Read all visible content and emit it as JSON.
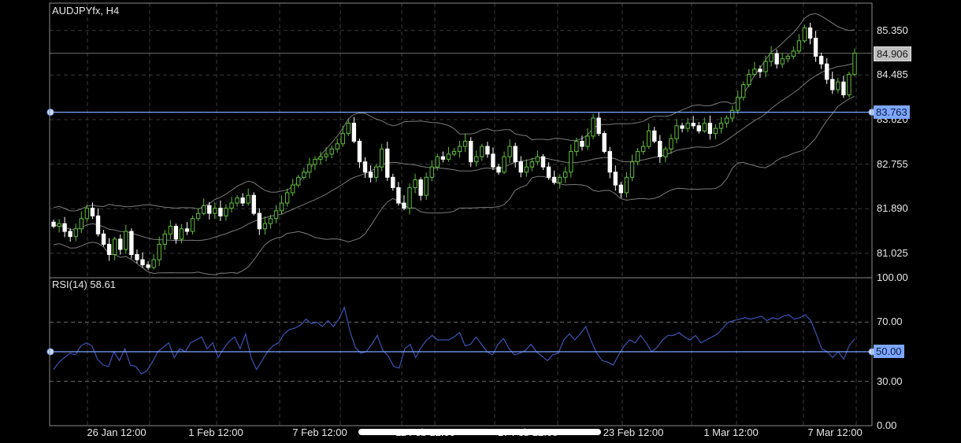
{
  "symbol_label": "AUDJPYfx, H4",
  "rsi_label": "RSI(14) 58.61",
  "price_tick_labels": [
    "85.350",
    "84.485",
    "83.620",
    "82.755",
    "81.890",
    "81.025"
  ],
  "current_price_label": "84.906",
  "hline_price_label": "83.763",
  "rsi_tick_labels": [
    "100.00",
    "70.00",
    "30.00",
    "0.00"
  ],
  "rsi_hline_label": "50.00",
  "time_labels": [
    "26 Jan 12:00",
    "1 Feb 12:00",
    "7 Feb 12:00",
    "11 Feb 12:00",
    "17 Feb 12:00",
    "23 Feb 12:00",
    "1 Mar 12:00",
    "7 Mar 12:00"
  ],
  "colors": {
    "background": "#000000",
    "grid": "#3a3a3a",
    "frame": "#8a8a8a",
    "bull_candle_fill": "#000000",
    "bull_candle_stroke": "#5fbf3a",
    "bear_candle": "#ffffff",
    "bollinger": "#9a9a9a",
    "horizontal_line": "#7da7ff",
    "rsi_line": "#3d52b5",
    "current_price_badge": "#c0c0c0"
  },
  "chart_data": [
    {
      "type": "candlestick",
      "title": "AUDJPYfx, H4",
      "indicator": "Bollinger Bands",
      "ylim": [
        80.55,
        85.88
      ],
      "yticks": [
        85.35,
        84.485,
        83.62,
        82.755,
        81.89,
        81.025
      ],
      "current_price": 84.906,
      "horizontal_line": 83.763,
      "x_ticks": [
        "26 Jan 12:00",
        "1 Feb 12:00",
        "7 Feb 12:00",
        "11 Feb 12:00",
        "17 Feb 12:00",
        "23 Feb 12:00",
        "1 Mar 12:00",
        "7 Mar 12:00"
      ],
      "close": [
        81.55,
        81.6,
        81.45,
        81.35,
        81.5,
        81.7,
        81.9,
        81.75,
        81.4,
        81.2,
        81.0,
        81.3,
        81.1,
        81.45,
        81.0,
        80.9,
        80.8,
        80.75,
        80.9,
        81.2,
        81.4,
        81.55,
        81.3,
        81.5,
        81.45,
        81.7,
        81.8,
        81.95,
        81.8,
        81.9,
        81.75,
        81.9,
        82.0,
        82.1,
        82.0,
        82.15,
        81.8,
        81.5,
        81.6,
        81.7,
        81.85,
        82.0,
        82.2,
        82.35,
        82.5,
        82.6,
        82.75,
        82.85,
        82.9,
        82.95,
        83.05,
        83.15,
        83.35,
        83.55,
        83.2,
        82.8,
        82.6,
        82.5,
        82.7,
        83.05,
        82.5,
        82.3,
        82.0,
        81.9,
        82.3,
        82.45,
        82.15,
        82.5,
        82.7,
        82.9,
        82.85,
        82.95,
        83.0,
        83.1,
        83.2,
        82.8,
        82.9,
        83.1,
        82.95,
        82.7,
        82.6,
        82.9,
        83.1,
        82.8,
        82.6,
        82.7,
        82.8,
        82.9,
        82.7,
        82.5,
        82.4,
        82.5,
        82.6,
        83.0,
        83.2,
        83.1,
        83.3,
        83.65,
        83.35,
        83.0,
        82.6,
        82.35,
        82.2,
        82.5,
        82.8,
        83.0,
        83.1,
        83.4,
        83.2,
        82.9,
        83.05,
        83.25,
        83.5,
        83.45,
        83.55,
        83.5,
        83.4,
        83.55,
        83.35,
        83.45,
        83.55,
        83.65,
        83.8,
        84.05,
        84.3,
        84.5,
        84.6,
        84.55,
        84.75,
        84.9,
        84.7,
        84.8,
        84.85,
        84.95,
        85.15,
        85.4,
        85.2,
        84.85,
        84.7,
        84.4,
        84.2,
        84.35,
        84.1,
        84.5,
        84.91
      ]
    },
    {
      "type": "line",
      "title": "RSI(14) 58.61",
      "ylim": [
        0,
        100
      ],
      "yticks": [
        100,
        70,
        30,
        0
      ],
      "horizontal_line": 50,
      "current_value": 58.61,
      "series": [
        {
          "values": [
            38,
            43,
            46,
            49,
            48,
            54,
            56,
            54,
            45,
            41,
            40,
            50,
            44,
            52,
            41,
            40,
            35,
            37,
            43,
            50,
            53,
            56,
            46,
            52,
            50,
            56,
            58,
            60,
            52,
            56,
            46,
            52,
            57,
            60,
            52,
            62,
            46,
            38,
            44,
            50,
            54,
            56,
            62,
            65,
            66,
            68,
            72,
            69,
            70,
            67,
            71,
            67,
            72,
            80,
            64,
            53,
            49,
            50,
            55,
            61,
            51,
            47,
            40,
            39,
            52,
            55,
            46,
            53,
            58,
            61,
            58,
            58,
            58,
            60,
            63,
            54,
            55,
            60,
            55,
            50,
            48,
            55,
            59,
            52,
            48,
            49,
            51,
            55,
            50,
            47,
            44,
            48,
            49,
            58,
            62,
            58,
            62,
            67,
            57,
            49,
            44,
            43,
            41,
            48,
            54,
            58,
            56,
            61,
            56,
            50,
            53,
            58,
            61,
            61,
            63,
            60,
            58,
            61,
            56,
            58,
            60,
            62,
            66,
            70,
            71,
            72,
            73,
            72,
            73,
            74,
            71,
            73,
            72,
            74,
            75,
            72,
            73,
            75,
            71,
            62,
            52,
            50,
            46,
            50,
            45,
            54,
            58.61
          ]
        }
      ]
    }
  ]
}
